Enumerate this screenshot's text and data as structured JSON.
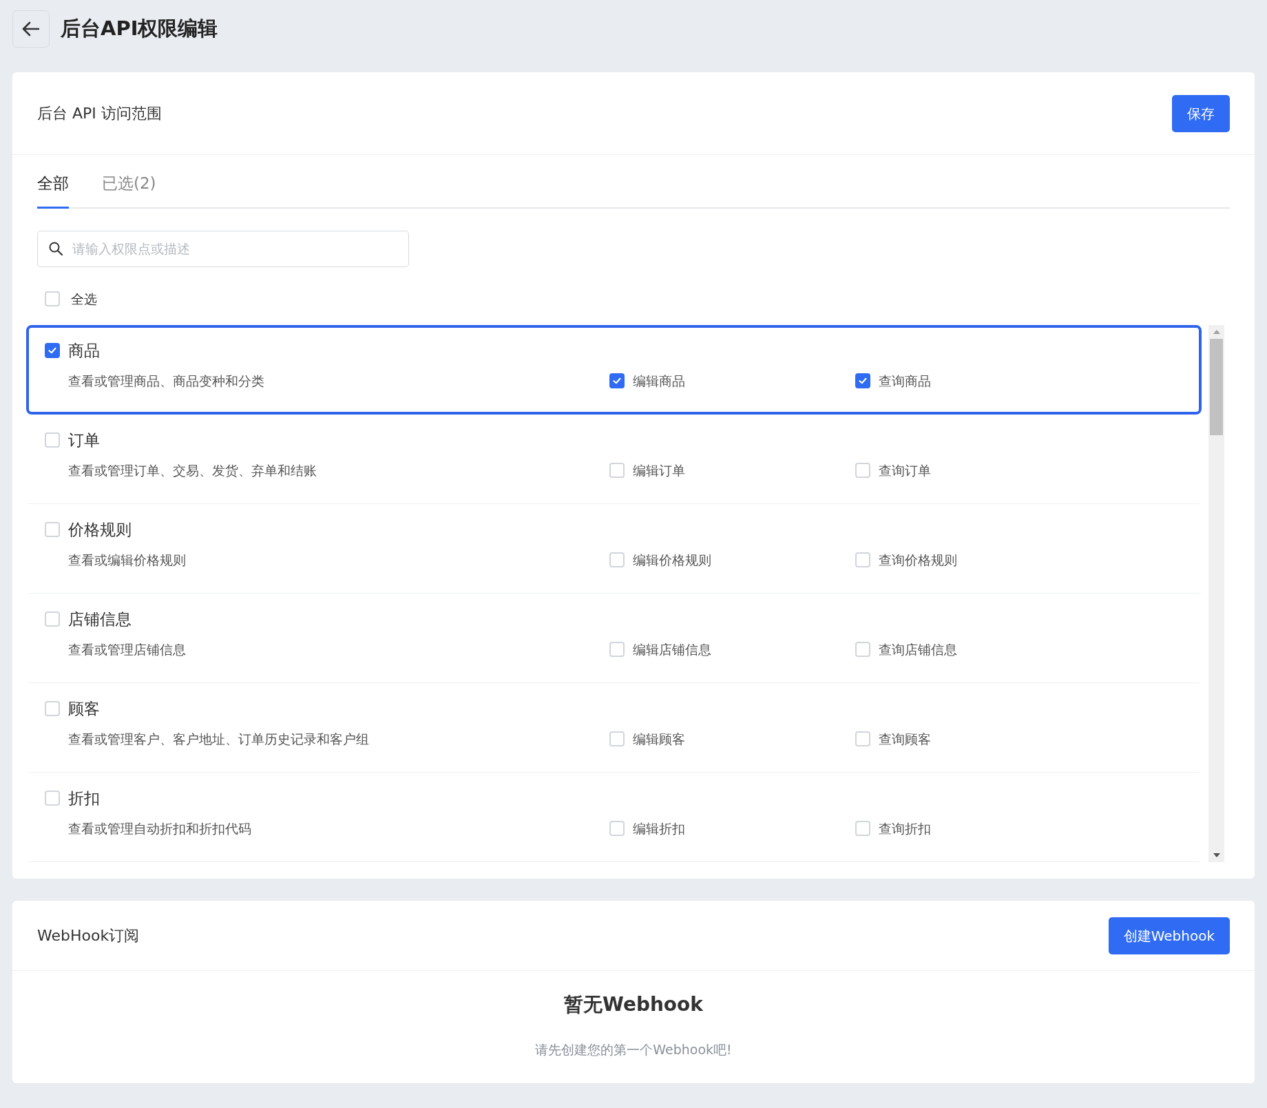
{
  "page": {
    "title": "后台API权限编辑"
  },
  "scope_card": {
    "title": "后台 API 访问范围",
    "save_button": "保存",
    "tabs": [
      {
        "label": "全部",
        "selected": true
      },
      {
        "label": "已选(2)",
        "selected": false
      }
    ],
    "search": {
      "placeholder": "请输入权限点或描述"
    },
    "select_all": {
      "label": "全选",
      "checked": false
    },
    "groups": [
      {
        "name": "商品",
        "checked": true,
        "highlighted": true,
        "description": "查看或管理商品、商品变种和分类",
        "permissions": [
          {
            "label": "编辑商品",
            "checked": true
          },
          {
            "label": "查询商品",
            "checked": true
          }
        ]
      },
      {
        "name": "订单",
        "checked": false,
        "highlighted": false,
        "description": "查看或管理订单、交易、发货、弃单和结账",
        "permissions": [
          {
            "label": "编辑订单",
            "checked": false
          },
          {
            "label": "查询订单",
            "checked": false
          }
        ]
      },
      {
        "name": "价格规则",
        "checked": false,
        "highlighted": false,
        "description": "查看或编辑价格规则",
        "permissions": [
          {
            "label": "编辑价格规则",
            "checked": false
          },
          {
            "label": "查询价格规则",
            "checked": false
          }
        ]
      },
      {
        "name": "店铺信息",
        "checked": false,
        "highlighted": false,
        "description": "查看或管理店铺信息",
        "permissions": [
          {
            "label": "编辑店铺信息",
            "checked": false
          },
          {
            "label": "查询店铺信息",
            "checked": false
          }
        ]
      },
      {
        "name": "顾客",
        "checked": false,
        "highlighted": false,
        "description": "查看或管理客户、客户地址、订单历史记录和客户组",
        "permissions": [
          {
            "label": "编辑顾客",
            "checked": false
          },
          {
            "label": "查询顾客",
            "checked": false
          }
        ]
      },
      {
        "name": "折扣",
        "checked": false,
        "highlighted": false,
        "description": "查看或管理自动折扣和折扣代码",
        "permissions": [
          {
            "label": "编辑折扣",
            "checked": false
          },
          {
            "label": "查询折扣",
            "checked": false
          }
        ]
      }
    ]
  },
  "webhook_card": {
    "title": "WebHook订阅",
    "create_button": "创建Webhook",
    "empty_title": "暂无Webhook",
    "empty_hint": "请先创建您的第一个Webhook吧!"
  }
}
